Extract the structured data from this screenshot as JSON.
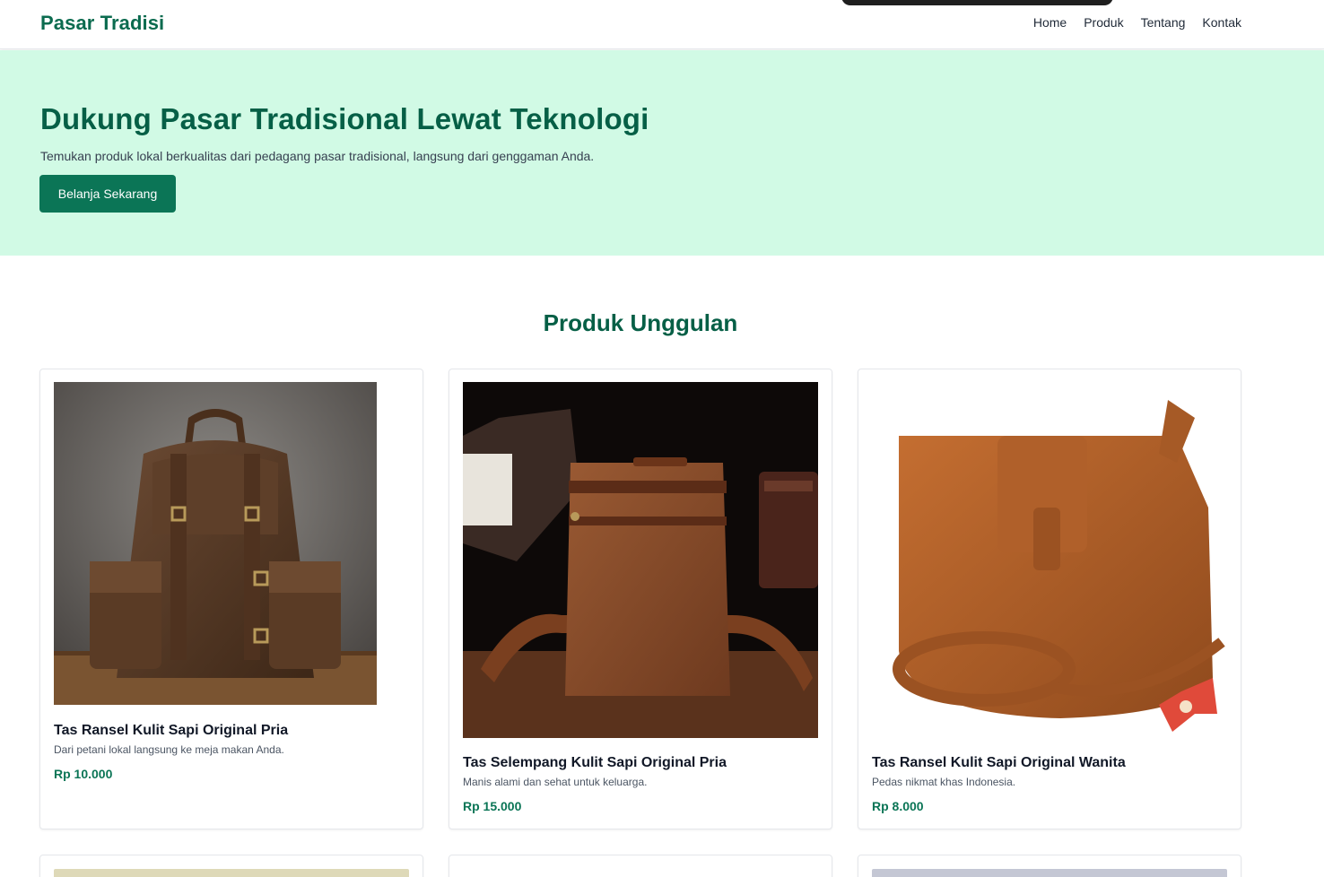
{
  "navbar": {
    "brand": "Pasar Tradisi",
    "links": [
      "Home",
      "Produk",
      "Tentang",
      "Kontak"
    ]
  },
  "hero": {
    "title": "Dukung Pasar Tradisional Lewat Teknologi",
    "subtitle": "Temukan produk lokal berkualitas dari pedagang pasar tradisional, langsung dari genggaman Anda.",
    "cta_label": "Belanja Sekarang"
  },
  "section": {
    "title": "Produk Unggulan"
  },
  "products": [
    {
      "name": "Tas Ransel Kulit Sapi Original Pria",
      "description": "Dari petani lokal langsung ke meja makan Anda.",
      "price": "Rp 10.000",
      "image_icon": "backpack-image"
    },
    {
      "name": "Tas Selempang Kulit Sapi Original Pria",
      "description": "Manis alami dan sehat untuk keluarga.",
      "price": "Rp 15.000",
      "image_icon": "sling-bag-image"
    },
    {
      "name": "Tas Ransel Kulit Sapi Original Wanita",
      "description": "Pedas nikmat khas Indonesia.",
      "price": "Rp 8.000",
      "image_icon": "shoulder-bag-image"
    }
  ],
  "colors": {
    "brand": "#0b6b4f",
    "hero_bg": "#d1fae5",
    "button": "#0b7556",
    "heading": "#065f46"
  }
}
